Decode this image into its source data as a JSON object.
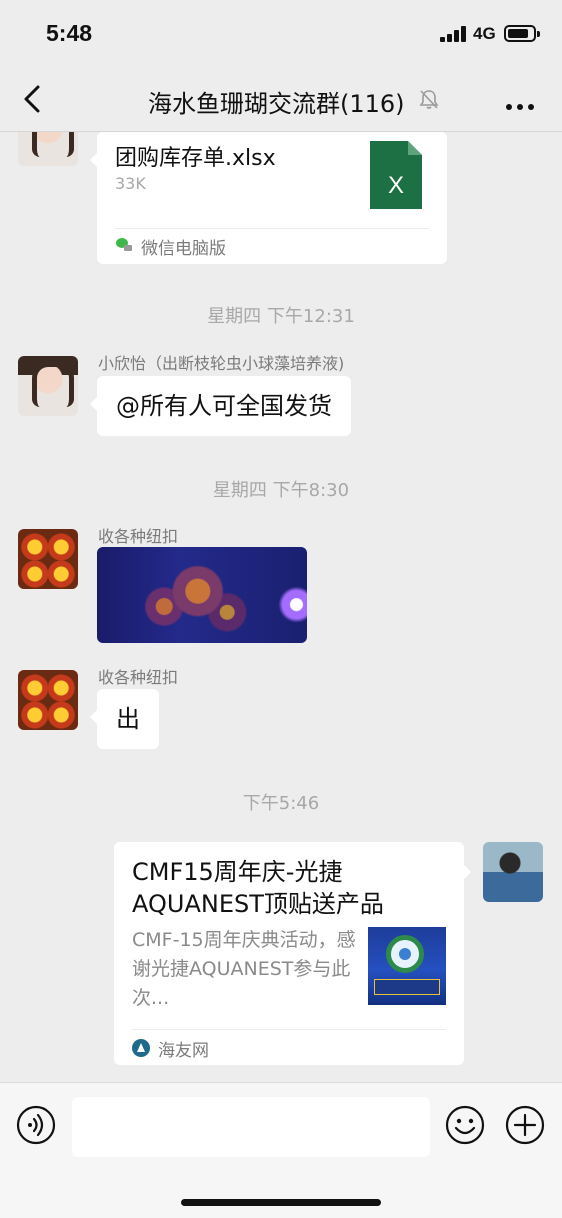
{
  "status_bar": {
    "time": "5:48",
    "network": "4G"
  },
  "nav": {
    "title": "海水鱼珊瑚交流群(116)"
  },
  "messages": {
    "file_card": {
      "file_name": "团购库存单.xlsx",
      "file_size": "33K",
      "file_icon_letter": "X",
      "source": "微信电脑版"
    },
    "time_1": "星期四 下午12:31",
    "msg_1": {
      "sender": "小欣怡（出断枝轮虫小球藻培养液)",
      "text": "@所有人可全国发货"
    },
    "time_2": "星期四 下午8:30",
    "msg_2": {
      "sender": "收各种纽扣"
    },
    "msg_3": {
      "sender": "收各种纽扣",
      "text": "出"
    },
    "time_3": "下午5:46",
    "link_card": {
      "title": "CMF15周年庆-光捷AQUANEST顶贴送产品",
      "description": "CMF-15周年庆典活动，感谢光捷AQUANEST参与此次...",
      "source": "海友网"
    }
  },
  "input": {
    "placeholder": ""
  },
  "colors": {
    "background": "#ededed",
    "bubble": "#ffffff",
    "excel_green": "#1d7044"
  }
}
